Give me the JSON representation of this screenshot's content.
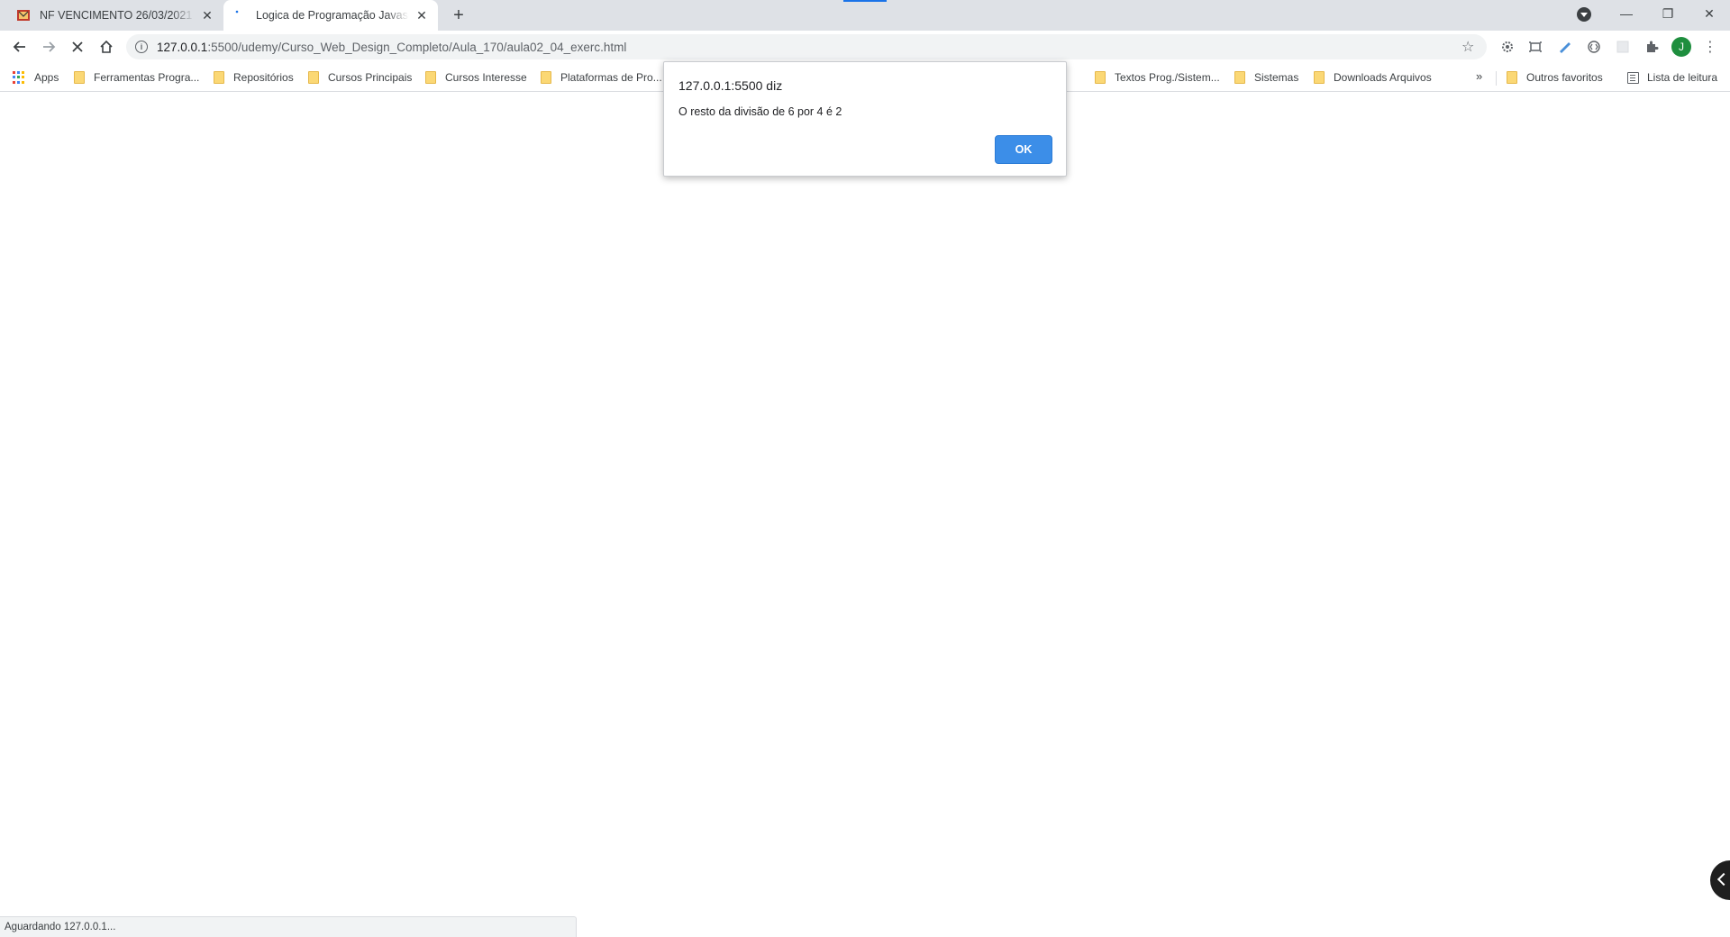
{
  "tabs": [
    {
      "title": "NF VENCIMENTO 26/03/2021 - jc",
      "favicon": "mail-favicon-icon",
      "active": false
    },
    {
      "title": "Logica de Programação Javascript",
      "favicon": "loading-favicon-icon",
      "active": true
    }
  ],
  "toolbar": {
    "url_host": "127.0.0.1",
    "url_path": ":5500/udemy/Curso_Web_Design_Completo/Aula_170/aula02_04_exerc.html",
    "avatar_letter": "J"
  },
  "bookmarks": {
    "apps_label": "Apps",
    "items": [
      "Ferramentas Progra...",
      "Repositórios",
      "Cursos Principais",
      "Cursos Interesse",
      "Plataformas de Pro...",
      "Textos Prog./Sistem...",
      "Sistemas",
      "Downloads Arquivos"
    ],
    "overflow_label": "»",
    "other_favorites": "Outros favoritos",
    "reading_list": "Lista de leitura"
  },
  "dialog": {
    "title": "127.0.0.1:5500 diz",
    "message": "O resto da divisão de 6 por 4 é 2",
    "ok_label": "OK"
  },
  "status": {
    "text": "Aguardando 127.0.0.1..."
  },
  "colors": {
    "accent": "#3c8ee8",
    "tabstrip": "#dee1e6",
    "folder": "#fbd875",
    "avatar": "#1e8e3e"
  }
}
